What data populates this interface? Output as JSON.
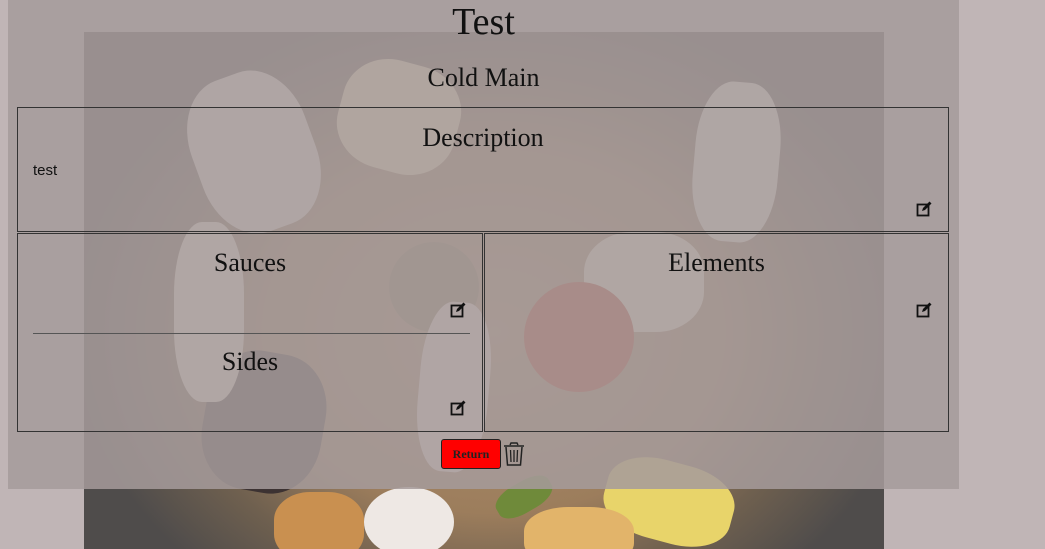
{
  "page": {
    "title": "Test",
    "category": "Cold Main"
  },
  "description": {
    "heading": "Description",
    "text": "test",
    "edit_icon": "edit-icon"
  },
  "sauces": {
    "heading": "Sauces",
    "edit_icon": "edit-icon"
  },
  "sides": {
    "heading": "Sides",
    "edit_icon": "edit-icon"
  },
  "elements": {
    "heading": "Elements",
    "edit_icon": "edit-icon"
  },
  "actions": {
    "return_label": "Return",
    "delete_icon": "trash-icon"
  },
  "colors": {
    "return_button": "#ff0000",
    "overlay": "#a59b9b",
    "page_background": "#c0b5b6"
  }
}
